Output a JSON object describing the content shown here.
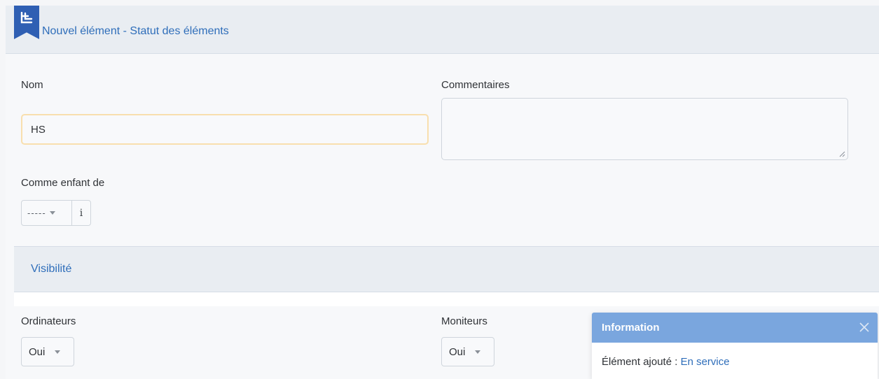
{
  "header": {
    "title": "Nouvel élément - Statut des éléments"
  },
  "form": {
    "name_label": "Nom",
    "name_value": "HS",
    "comments_label": "Commentaires",
    "comments_value": "",
    "parent_label": "Comme enfant de",
    "parent_value": "-----",
    "parent_info": "i"
  },
  "visibility": {
    "title": "Visibilité",
    "computers_label": "Ordinateurs",
    "computers_value": "Oui",
    "monitors_label": "Moniteurs",
    "monitors_value": "Oui"
  },
  "toast": {
    "title": "Information",
    "message": "Élément ajouté : ",
    "link_text": "En service"
  },
  "colors": {
    "accent": "#2f6eba",
    "flag": "#2f5fb3",
    "toast_header": "#7aa6de",
    "focus_border": "#f8dfae"
  },
  "icons": {
    "header": "form-flag-icon",
    "close": "close-icon",
    "caret": "chevron-down-icon",
    "info": "info-icon",
    "grip": "resize-grip-icon"
  }
}
